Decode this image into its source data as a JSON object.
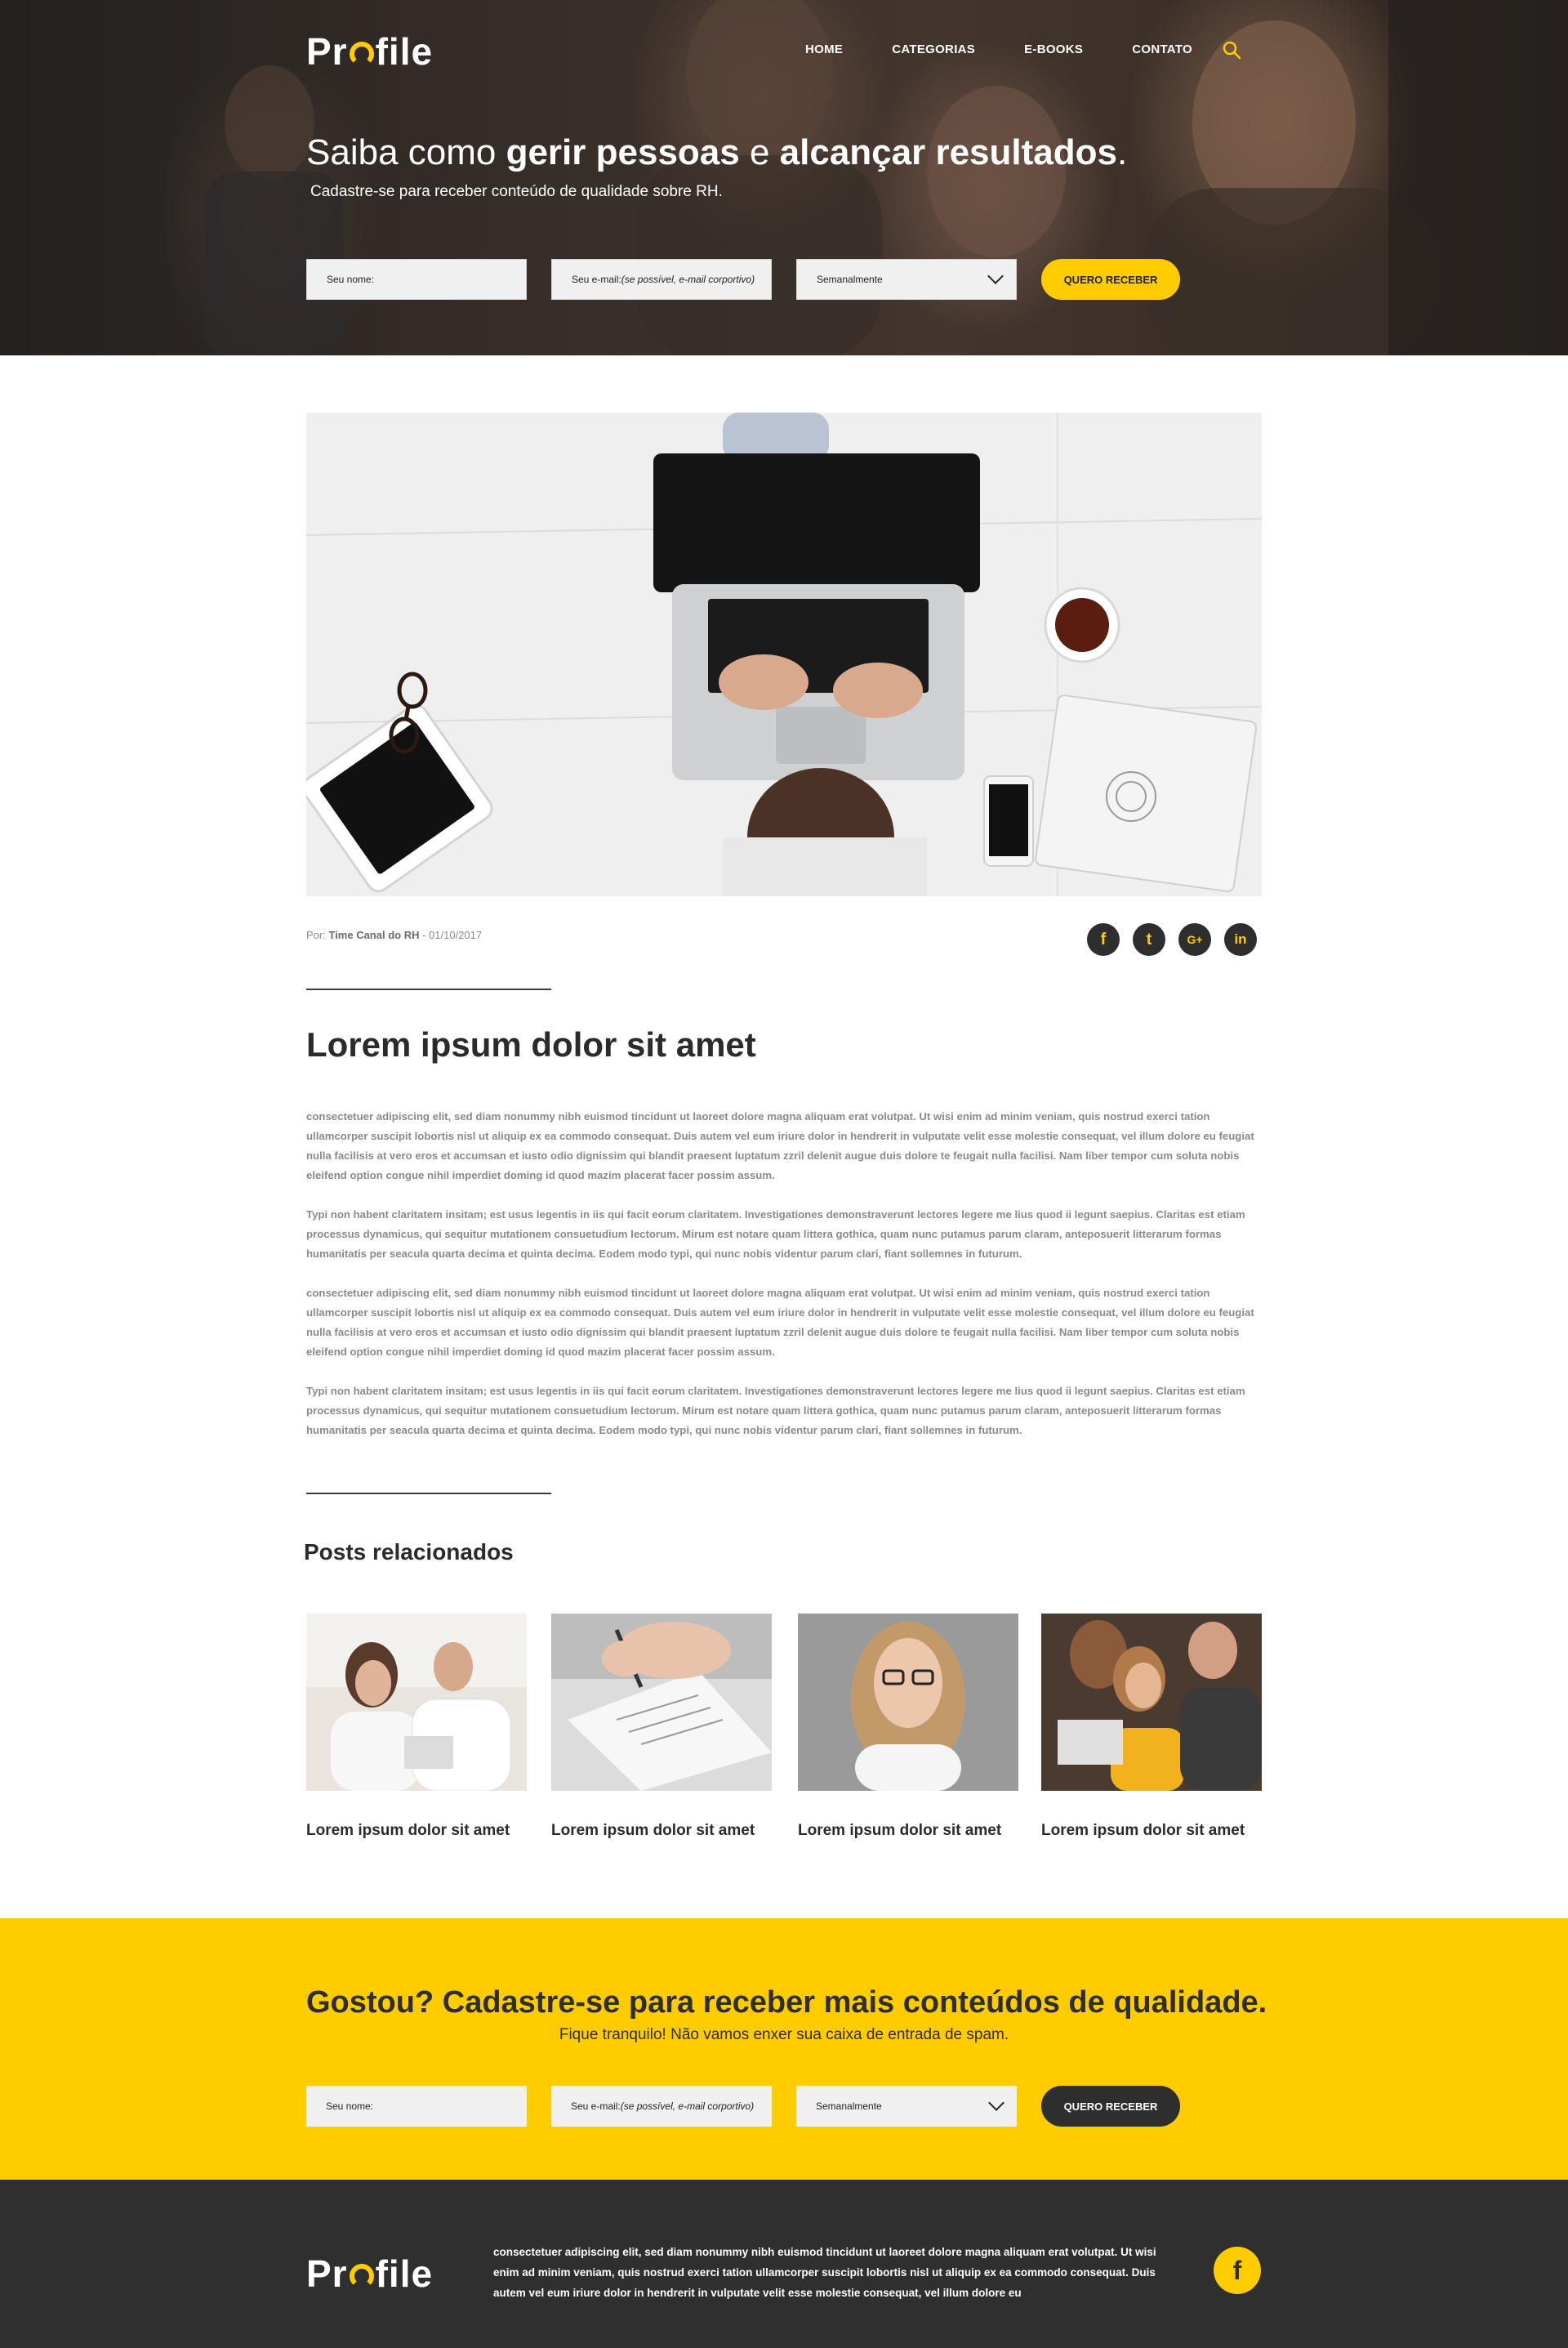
{
  "header": {
    "logo": {
      "prefix": "Pr",
      "suffix": "file"
    },
    "nav": [
      {
        "label": "HOME"
      },
      {
        "label": "CATEGORIAS"
      },
      {
        "label": "E-BOOKS"
      },
      {
        "label": "CONTATO"
      }
    ],
    "search_icon": "search-icon",
    "hero": {
      "title_part1": "Saiba como ",
      "title_bold1": "gerir pessoas",
      "title_part2": " e ",
      "title_bold2": "alcançar resultados",
      "title_part3": ".",
      "subtitle": "Cadastre-se para receber conteúdo de qualidade sobre RH."
    },
    "form": {
      "name_label": "Seu nome:",
      "email_label": "Seu e-mail: ",
      "email_hint": "(se possível, e-mail corportivo)",
      "frequency_value": "Semanalmente",
      "submit_label": "QUERO RECEBER"
    }
  },
  "article": {
    "meta_prefix": "Por: ",
    "author": "Time Canal do RH",
    "date": " - 01/10/2017",
    "social": [
      {
        "name": "facebook",
        "glyph": "f"
      },
      {
        "name": "twitter",
        "glyph": "t"
      },
      {
        "name": "google-plus",
        "glyph": "G+"
      },
      {
        "name": "linkedin",
        "glyph": "in"
      }
    ],
    "title": "Lorem ipsum dolor sit amet",
    "paragraphs": [
      "consectetuer adipiscing elit, sed diam nonummy nibh euismod tincidunt ut laoreet dolore magna aliquam erat volutpat. Ut wisi enim ad minim veniam, quis nostrud exerci tation ullamcorper suscipit lobortis nisl ut aliquip ex ea commodo consequat. Duis autem vel eum iriure dolor in hendrerit in vulputate velit esse molestie consequat, vel illum dolore eu feugiat nulla facilisis at vero eros et accumsan et iusto odio dignissim qui blandit praesent luptatum zzril delenit augue duis dolore te feugait nulla facilisi. Nam liber tempor cum soluta nobis eleifend option congue nihil imperdiet doming id quod mazim placerat facer possim assum.",
      "Typi non habent claritatem insitam; est usus legentis in iis qui facit eorum claritatem. Investigationes demonstraverunt lectores legere me lius quod ii legunt saepius. Claritas est etiam processus dynamicus, qui sequitur mutationem consuetudium lectorum. Mirum est notare quam littera gothica, quam nunc putamus parum claram, anteposuerit litterarum formas humanitatis per seacula quarta decima et quinta decima. Eodem modo typi, qui nunc nobis videntur parum clari, fiant sollemnes in futurum.",
      "consectetuer adipiscing elit, sed diam nonummy nibh euismod tincidunt ut laoreet dolore magna aliquam erat volutpat. Ut wisi enim ad minim veniam, quis nostrud exerci tation ullamcorper suscipit lobortis nisl ut aliquip ex ea commodo consequat. Duis autem vel eum iriure dolor in hendrerit in vulputate velit esse molestie consequat, vel illum dolore eu feugiat nulla facilisis at vero eros et accumsan et iusto odio dignissim qui blandit praesent luptatum zzril delenit augue duis dolore te feugait nulla facilisi. Nam liber tempor cum soluta nobis eleifend option congue nihil imperdiet doming id quod mazim placerat facer possim assum.",
      "Typi non habent claritatem insitam; est usus legentis in iis qui facit eorum claritatem. Investigationes demonstraverunt lectores legere me lius quod ii legunt saepius. Claritas est etiam processus dynamicus, qui sequitur mutationem consuetudium lectorum. Mirum est notare quam littera gothica, quam nunc putamus parum claram, anteposuerit litterarum formas humanitatis per seacula quarta decima et quinta decima. Eodem modo typi, qui nunc nobis videntur parum clari, fiant sollemnes in futurum."
    ]
  },
  "related": {
    "title": "Posts relacionados",
    "posts": [
      {
        "caption": "Lorem ipsum dolor sit amet"
      },
      {
        "caption": "Lorem ipsum dolor sit amet"
      },
      {
        "caption": "Lorem ipsum dolor sit amet"
      },
      {
        "caption": "Lorem ipsum dolor sit amet"
      }
    ]
  },
  "newsletter": {
    "title": "Gostou? Cadastre-se para receber mais conteúdos de qualidade.",
    "subtitle": "Fique tranquilo! Não vamos enxer sua caixa de entrada de spam.",
    "name_label": "Seu nome:",
    "email_label": "Seu e-mail: ",
    "email_hint": "(se possível, e-mail corportivo)",
    "frequency_value": "Semanalmente",
    "submit_label": "QUERO RECEBER"
  },
  "footer": {
    "logo": {
      "prefix": "Pr",
      "suffix": "file"
    },
    "text": "consectetuer adipiscing elit, sed diam nonummy nibh euismod tincidunt ut laoreet dolore magna aliquam erat volutpat. Ut wisi enim ad minim veniam, quis nostrud exerci tation ullamcorper suscipit lobortis nisl ut aliquip ex ea commodo consequat. Duis autem vel eum iriure dolor in hendrerit in vulputate velit esse molestie consequat, vel illum dolore eu",
    "facebook_glyph": "f"
  },
  "colors": {
    "accent": "#ffcc00",
    "dark": "#2e2e2e",
    "body_text": "#8a8a8a"
  }
}
